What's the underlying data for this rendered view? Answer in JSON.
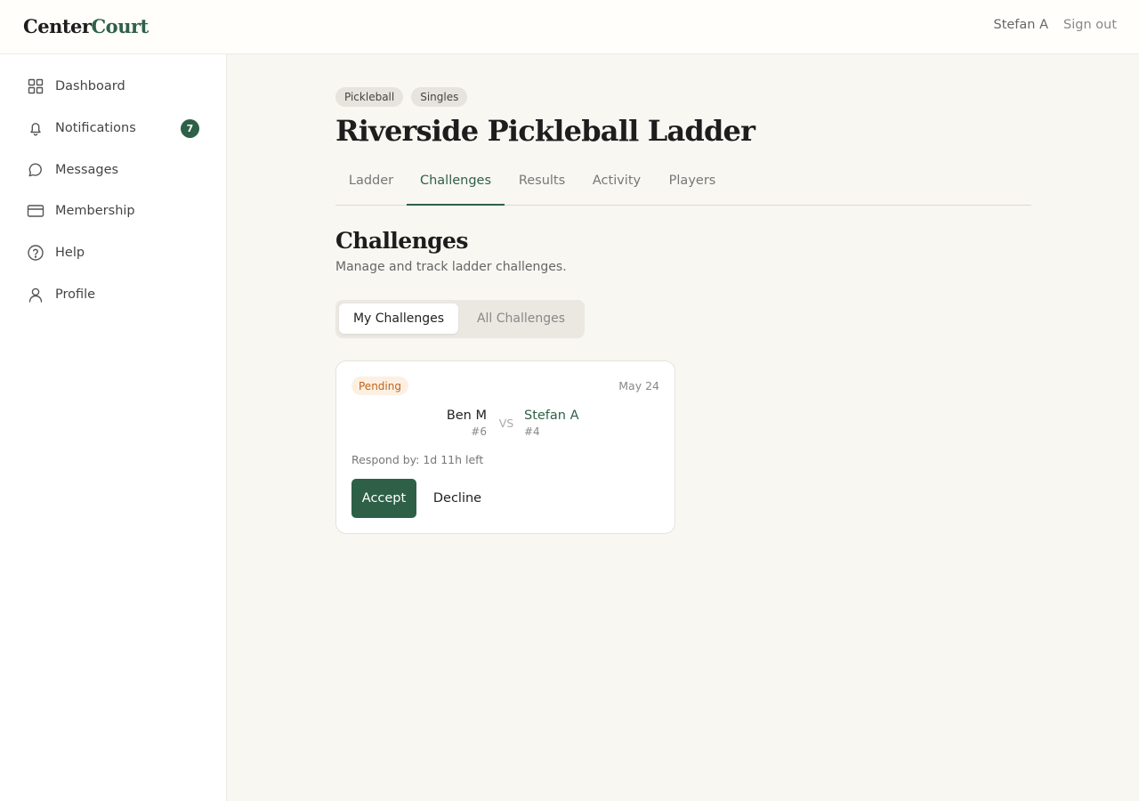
{
  "header": {
    "logo_part1": "Center",
    "logo_part2": "Court",
    "user_name": "Stefan A",
    "sign_out_label": "Sign out"
  },
  "sidebar": {
    "items": [
      {
        "label": "Dashboard",
        "icon": "grid-icon"
      },
      {
        "label": "Notifications",
        "icon": "bell-icon",
        "badge": "7"
      },
      {
        "label": "Messages",
        "icon": "chat-icon"
      },
      {
        "label": "Membership",
        "icon": "card-icon"
      },
      {
        "label": "Help",
        "icon": "help-icon"
      },
      {
        "label": "Profile",
        "icon": "user-icon"
      }
    ]
  },
  "page": {
    "tags": [
      "Pickleball",
      "Singles"
    ],
    "title": "Riverside Pickleball Ladder",
    "tabs": [
      {
        "label": "Ladder",
        "active": false
      },
      {
        "label": "Challenges",
        "active": true
      },
      {
        "label": "Results",
        "active": false
      },
      {
        "label": "Activity",
        "active": false
      },
      {
        "label": "Players",
        "active": false
      }
    ]
  },
  "challenges": {
    "title": "Challenges",
    "subtitle": "Manage and track ladder challenges.",
    "toggle": [
      {
        "label": "My Challenges",
        "active": true
      },
      {
        "label": "All Challenges",
        "active": false
      }
    ],
    "card": {
      "status": "Pending",
      "date": "May 24",
      "player_left": {
        "name": "Ben M",
        "rank": "#6"
      },
      "vs_label": "VS",
      "player_right": {
        "name": "Stefan A",
        "rank": "#4"
      },
      "respond_text": "Respond by: 1d 11h left",
      "accept_label": "Accept",
      "decline_label": "Decline"
    }
  },
  "colors": {
    "accent": "#2e6048",
    "background": "#f9f7f2",
    "pending_bg": "#fdf0e3",
    "pending_text": "#c0641a"
  }
}
